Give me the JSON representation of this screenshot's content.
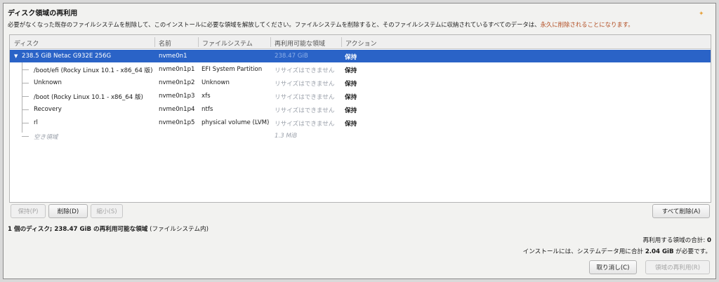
{
  "dialog": {
    "title": "ディスク領域の再利用",
    "description_main": "必要がなくなった既存のファイルシステムを削除して、このインストールに必要な領域を解放してください。ファイルシステムを削除すると、そのファイルシステムに収納されているすべてのデータは、",
    "description_warning": "永久に削除されることになります。",
    "spark_icon": "sparkle-icon"
  },
  "table": {
    "columns": [
      "ディスク",
      "名前",
      "ファイルシステム",
      "再利用可能な領域",
      "アクション"
    ],
    "disk_row": {
      "expander_icon": "triangle-down-icon",
      "disk": "238.5 GiB Netac G932E 256G",
      "name": "nvme0n1",
      "filesystem": "",
      "reclaimable": "238.47 GiB",
      "action": "保持"
    },
    "rows": [
      {
        "disk": "/boot/efi (Rocky Linux 10.1 - x86_64 版)",
        "name": "nvme0n1p1",
        "filesystem": "EFI System Partition",
        "reclaimable": "リサイズはできません",
        "action": "保持"
      },
      {
        "disk": "Unknown",
        "name": "nvme0n1p2",
        "filesystem": "Unknown",
        "reclaimable": "リサイズはできません",
        "action": "保持"
      },
      {
        "disk": "/boot (Rocky Linux 10.1 - x86_64 版)",
        "name": "nvme0n1p3",
        "filesystem": "xfs",
        "reclaimable": "リサイズはできません",
        "action": "保持"
      },
      {
        "disk": "Recovery",
        "name": "nvme0n1p4",
        "filesystem": "ntfs",
        "reclaimable": "リサイズはできません",
        "action": "保持"
      },
      {
        "disk": "rl",
        "name": "nvme0n1p5",
        "filesystem": "physical volume (LVM)",
        "reclaimable": "リサイズはできません",
        "action": "保持"
      }
    ],
    "free_row": {
      "disk": "空き領域",
      "reclaimable": "1.3 MiB"
    }
  },
  "buttons": {
    "keep": "保持(P)",
    "delete": "削除(D)",
    "shrink": "縮小(S)",
    "delete_all": "すべて削除(A)",
    "cancel": "取り消し(C)",
    "reclaim": "領域の再利用(R)"
  },
  "summary": {
    "prefix": "1 個のディスク; 238.47 GiB の再利用可能な領域",
    "suffix": " (ファイルシステム内)"
  },
  "totals": {
    "reclaim_label": "再利用する領域の合計: ",
    "reclaim_value": "0",
    "need_prefix": "インストールには、システムデータ用に合計 ",
    "need_value": "2.04 GiB",
    "need_suffix": " が必要です。"
  }
}
